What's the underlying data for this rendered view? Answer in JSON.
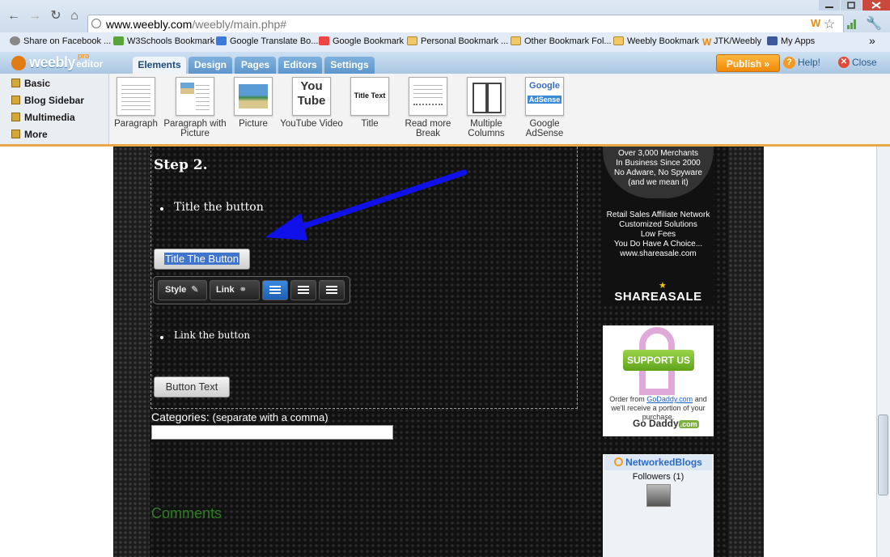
{
  "browser": {
    "url_domain": "www.weebly.com",
    "url_path": "/weebly/main.php#",
    "bookmarks": [
      {
        "label": "Share on Facebook ...",
        "icon": "facebook-share-icon"
      },
      {
        "label": "W3Schools Bookmark",
        "icon": "w3schools-icon"
      },
      {
        "label": "Google Translate Bo...",
        "icon": "translate-icon"
      },
      {
        "label": "Google Bookmark",
        "icon": "google-icon"
      },
      {
        "label": "Personal Bookmark ...",
        "icon": "folder-icon"
      },
      {
        "label": "Other Bookmark Fol...",
        "icon": "folder-icon"
      },
      {
        "label": "Weebly Bookmark",
        "icon": "folder-icon"
      },
      {
        "label": "JTK/Weebly",
        "icon": "weebly-icon"
      },
      {
        "label": "My Apps",
        "icon": "facebook-icon"
      }
    ],
    "more_bookmarks": "»"
  },
  "editor": {
    "logo": "weebly",
    "logo_pro": "pro",
    "logo_editor": "editor",
    "tabs": [
      "Elements",
      "Design",
      "Pages",
      "Editors",
      "Settings"
    ],
    "publish": "Publish »",
    "help": "Help!",
    "close": "Close",
    "categories": [
      "Basic",
      "Blog Sidebar",
      "Multimedia",
      "More"
    ],
    "elements": [
      {
        "label": "Paragraph"
      },
      {
        "label": "Paragraph with Picture"
      },
      {
        "label": "Picture"
      },
      {
        "label": "YouTube Video"
      },
      {
        "label": "Title"
      },
      {
        "label": "Read more Break"
      },
      {
        "label": "Multiple Columns"
      },
      {
        "label": "Google AdSense"
      }
    ],
    "thumb_title_text": "Title Text",
    "thumb_youtube": "You Tube",
    "thumb_google": "Google",
    "thumb_adsense": "AdSense"
  },
  "page": {
    "step": "Step 2.",
    "bullet1": "Title the button",
    "button1": "Title The Button",
    "toolbar_style": "Style",
    "toolbar_link": "Link",
    "bullet2": "Link the button",
    "button2": "Button Text",
    "categories_label": "Categories:",
    "categories_hint": "(separate with a comma)",
    "comments": "Comments"
  },
  "sidebar": {
    "ad1_lines": [
      "Over 3,000 Merchants",
      "In Business Since 2000",
      "No Adware, No Spyware",
      "(and we mean it)"
    ],
    "ad1_lines2": [
      "Retail Sales Affiliate Network",
      "Customized Solutions",
      "Low Fees",
      "You Do Have A Choice...",
      "www.shareasale.com"
    ],
    "shareasale": "SHAREASALE",
    "support_us": "SUPPORT US",
    "ad2_pre": "Order from",
    "ad2_link": "GoDaddy.com",
    "ad2_post": "and we'll receive a portion of your purchase.",
    "godaddy": "Go Daddy",
    "godaddy_com": ".com",
    "networked_blogs": "NetworkedBlogs",
    "followers": "Followers (1)"
  },
  "colors": {
    "publish": "#f08a08",
    "highlight": "#3f75cd",
    "arrow": "#1010e8",
    "comments": "#2e7d24"
  }
}
